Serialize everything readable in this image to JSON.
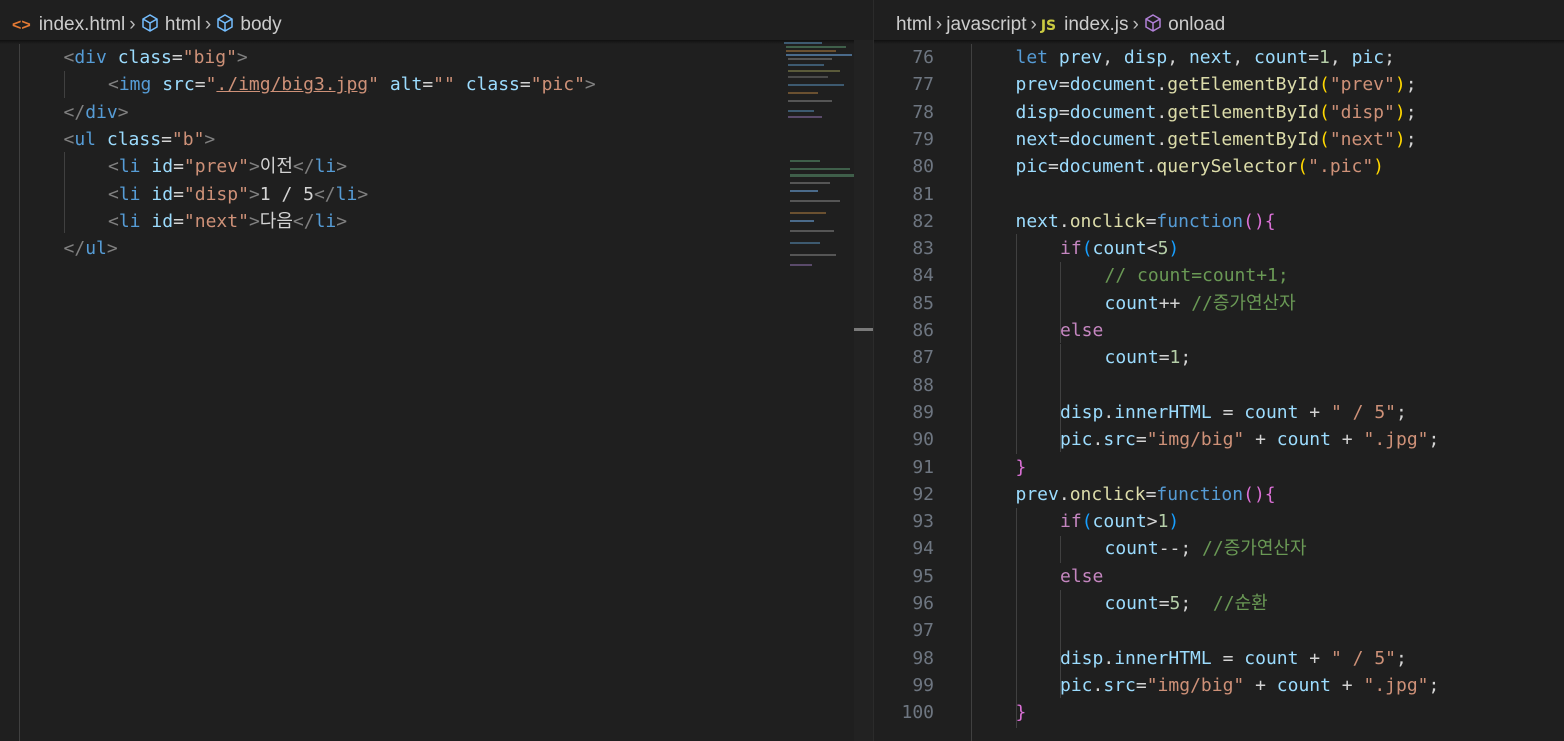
{
  "left": {
    "breadcrumb": [
      "index.html",
      "html",
      "body"
    ],
    "code": [
      {
        "indent": 1,
        "tokens": [
          [
            "tag",
            "<"
          ],
          [
            "tn",
            "div"
          ],
          [
            "pl",
            " "
          ],
          [
            "an",
            "class"
          ],
          [
            "pl",
            "="
          ],
          [
            "av",
            "\"big\""
          ],
          [
            "tag",
            ">"
          ]
        ]
      },
      {
        "indent": 2,
        "tokens": [
          [
            "tag",
            "<"
          ],
          [
            "tn",
            "img"
          ],
          [
            "pl",
            " "
          ],
          [
            "an",
            "src"
          ],
          [
            "pl",
            "="
          ],
          [
            "av",
            "\""
          ],
          [
            "avu",
            "./img/big3.jpg"
          ],
          [
            "av",
            "\""
          ],
          [
            "pl",
            " "
          ],
          [
            "an",
            "alt"
          ],
          [
            "pl",
            "="
          ],
          [
            "av",
            "\"\""
          ],
          [
            "pl",
            " "
          ],
          [
            "an",
            "class"
          ],
          [
            "pl",
            "="
          ],
          [
            "av",
            "\"pic\""
          ],
          [
            "tag",
            ">"
          ]
        ]
      },
      {
        "indent": 1,
        "tokens": [
          [
            "tag",
            "</"
          ],
          [
            "tn",
            "div"
          ],
          [
            "tag",
            ">"
          ]
        ]
      },
      {
        "indent": 1,
        "tokens": [
          [
            "tag",
            "<"
          ],
          [
            "tn",
            "ul"
          ],
          [
            "pl",
            " "
          ],
          [
            "an",
            "class"
          ],
          [
            "pl",
            "="
          ],
          [
            "av",
            "\"b\""
          ],
          [
            "tag",
            ">"
          ]
        ]
      },
      {
        "indent": 2,
        "tokens": [
          [
            "tag",
            "<"
          ],
          [
            "tn",
            "li"
          ],
          [
            "pl",
            " "
          ],
          [
            "an",
            "id"
          ],
          [
            "pl",
            "="
          ],
          [
            "av",
            "\"prev\""
          ],
          [
            "tag",
            ">"
          ],
          [
            "pl",
            "이전"
          ],
          [
            "tag",
            "</"
          ],
          [
            "tn",
            "li"
          ],
          [
            "tag",
            ">"
          ]
        ]
      },
      {
        "indent": 2,
        "tokens": [
          [
            "tag",
            "<"
          ],
          [
            "tn",
            "li"
          ],
          [
            "pl",
            " "
          ],
          [
            "an",
            "id"
          ],
          [
            "pl",
            "="
          ],
          [
            "av",
            "\"disp\""
          ],
          [
            "tag",
            ">"
          ],
          [
            "pl",
            "1 / 5"
          ],
          [
            "tag",
            "</"
          ],
          [
            "tn",
            "li"
          ],
          [
            "tag",
            ">"
          ]
        ]
      },
      {
        "indent": 2,
        "tokens": [
          [
            "tag",
            "<"
          ],
          [
            "tn",
            "li"
          ],
          [
            "pl",
            " "
          ],
          [
            "an",
            "id"
          ],
          [
            "pl",
            "="
          ],
          [
            "av",
            "\"next\""
          ],
          [
            "tag",
            ">"
          ],
          [
            "pl",
            "다음"
          ],
          [
            "tag",
            "</"
          ],
          [
            "tn",
            "li"
          ],
          [
            "tag",
            ">"
          ]
        ]
      },
      {
        "indent": 1,
        "tokens": [
          [
            "tag",
            "</"
          ],
          [
            "tn",
            "ul"
          ],
          [
            "tag",
            ">"
          ]
        ]
      }
    ]
  },
  "right": {
    "breadcrumb": [
      "html",
      "javascript",
      "index.js",
      "onload"
    ],
    "first_line": 76,
    "code": [
      {
        "indent": 1,
        "tokens": [
          [
            "kw",
            "let"
          ],
          [
            "pl",
            " "
          ],
          [
            "var",
            "prev"
          ],
          [
            "pl",
            ", "
          ],
          [
            "var",
            "disp"
          ],
          [
            "pl",
            ", "
          ],
          [
            "var",
            "next"
          ],
          [
            "pl",
            ", "
          ],
          [
            "var",
            "count"
          ],
          [
            "pl",
            "="
          ],
          [
            "num",
            "1"
          ],
          [
            "pl",
            ", "
          ],
          [
            "var",
            "pic"
          ],
          [
            "pl",
            ";"
          ]
        ]
      },
      {
        "indent": 1,
        "tokens": [
          [
            "var",
            "prev"
          ],
          [
            "pl",
            "="
          ],
          [
            "var",
            "document"
          ],
          [
            "pl",
            "."
          ],
          [
            "fn",
            "getElementById"
          ],
          [
            "br1",
            "("
          ],
          [
            "str",
            "\"prev\""
          ],
          [
            "br1",
            ")"
          ],
          [
            "pl",
            ";"
          ]
        ]
      },
      {
        "indent": 1,
        "tokens": [
          [
            "var",
            "disp"
          ],
          [
            "pl",
            "="
          ],
          [
            "var",
            "document"
          ],
          [
            "pl",
            "."
          ],
          [
            "fn",
            "getElementById"
          ],
          [
            "br1",
            "("
          ],
          [
            "str",
            "\"disp\""
          ],
          [
            "br1",
            ")"
          ],
          [
            "pl",
            ";"
          ]
        ]
      },
      {
        "indent": 1,
        "tokens": [
          [
            "var",
            "next"
          ],
          [
            "pl",
            "="
          ],
          [
            "var",
            "document"
          ],
          [
            "pl",
            "."
          ],
          [
            "fn",
            "getElementById"
          ],
          [
            "br1",
            "("
          ],
          [
            "str",
            "\"next\""
          ],
          [
            "br1",
            ")"
          ],
          [
            "pl",
            ";"
          ]
        ]
      },
      {
        "indent": 1,
        "tokens": [
          [
            "var",
            "pic"
          ],
          [
            "pl",
            "="
          ],
          [
            "var",
            "document"
          ],
          [
            "pl",
            "."
          ],
          [
            "fn",
            "querySelector"
          ],
          [
            "br1",
            "("
          ],
          [
            "str",
            "\".pic\""
          ],
          [
            "br1",
            ")"
          ]
        ]
      },
      {
        "indent": 0,
        "tokens": []
      },
      {
        "indent": 1,
        "tokens": [
          [
            "var",
            "next"
          ],
          [
            "pl",
            "."
          ],
          [
            "fn",
            "onclick"
          ],
          [
            "pl",
            "="
          ],
          [
            "kw",
            "function"
          ],
          [
            "br2",
            "("
          ],
          [
            "br2",
            ")"
          ],
          [
            "br2",
            "{"
          ]
        ]
      },
      {
        "indent": 2,
        "tokens": [
          [
            "ctl",
            "if"
          ],
          [
            "br3",
            "("
          ],
          [
            "var",
            "count"
          ],
          [
            "pl",
            "<"
          ],
          [
            "num",
            "5"
          ],
          [
            "br3",
            ")"
          ]
        ]
      },
      {
        "indent": 3,
        "tokens": [
          [
            "cm",
            "// count=count+1;"
          ]
        ]
      },
      {
        "indent": 3,
        "tokens": [
          [
            "var",
            "count"
          ],
          [
            "pl",
            "++ "
          ],
          [
            "cm",
            "//증가연산자"
          ]
        ]
      },
      {
        "indent": 2,
        "tokens": [
          [
            "ctl",
            "else"
          ]
        ]
      },
      {
        "indent": 3,
        "tokens": [
          [
            "var",
            "count"
          ],
          [
            "pl",
            "="
          ],
          [
            "num",
            "1"
          ],
          [
            "pl",
            ";"
          ]
        ]
      },
      {
        "indent": 0,
        "tokens": []
      },
      {
        "indent": 2,
        "tokens": [
          [
            "var",
            "disp"
          ],
          [
            "pl",
            "."
          ],
          [
            "var",
            "innerHTML"
          ],
          [
            "pl",
            " = "
          ],
          [
            "var",
            "count"
          ],
          [
            "pl",
            " + "
          ],
          [
            "str",
            "\" / 5\""
          ],
          [
            "pl",
            ";"
          ]
        ]
      },
      {
        "indent": 2,
        "tokens": [
          [
            "var",
            "pic"
          ],
          [
            "pl",
            "."
          ],
          [
            "var",
            "src"
          ],
          [
            "pl",
            "="
          ],
          [
            "str",
            "\"img/big\""
          ],
          [
            "pl",
            " + "
          ],
          [
            "var",
            "count"
          ],
          [
            "pl",
            " + "
          ],
          [
            "str",
            "\".jpg\""
          ],
          [
            "pl",
            ";"
          ]
        ]
      },
      {
        "indent": 1,
        "tokens": [
          [
            "br2",
            "}"
          ]
        ]
      },
      {
        "indent": 1,
        "tokens": [
          [
            "var",
            "prev"
          ],
          [
            "pl",
            "."
          ],
          [
            "fn",
            "onclick"
          ],
          [
            "pl",
            "="
          ],
          [
            "kw",
            "function"
          ],
          [
            "br2",
            "("
          ],
          [
            "br2",
            ")"
          ],
          [
            "br2",
            "{"
          ]
        ]
      },
      {
        "indent": 2,
        "tokens": [
          [
            "ctl",
            "if"
          ],
          [
            "br3",
            "("
          ],
          [
            "var",
            "count"
          ],
          [
            "pl",
            ">"
          ],
          [
            "num",
            "1"
          ],
          [
            "br3",
            ")"
          ]
        ]
      },
      {
        "indent": 3,
        "tokens": [
          [
            "var",
            "count"
          ],
          [
            "pl",
            "--; "
          ],
          [
            "cm",
            "//증가연산자"
          ]
        ]
      },
      {
        "indent": 2,
        "tokens": [
          [
            "ctl",
            "else"
          ]
        ]
      },
      {
        "indent": 3,
        "tokens": [
          [
            "var",
            "count"
          ],
          [
            "pl",
            "="
          ],
          [
            "num",
            "5"
          ],
          [
            "pl",
            ";  "
          ],
          [
            "cm",
            "//순환"
          ]
        ]
      },
      {
        "indent": 0,
        "tokens": []
      },
      {
        "indent": 2,
        "tokens": [
          [
            "var",
            "disp"
          ],
          [
            "pl",
            "."
          ],
          [
            "var",
            "innerHTML"
          ],
          [
            "pl",
            " = "
          ],
          [
            "var",
            "count"
          ],
          [
            "pl",
            " + "
          ],
          [
            "str",
            "\" / 5\""
          ],
          [
            "pl",
            ";"
          ]
        ]
      },
      {
        "indent": 2,
        "tokens": [
          [
            "var",
            "pic"
          ],
          [
            "pl",
            "."
          ],
          [
            "var",
            "src"
          ],
          [
            "pl",
            "="
          ],
          [
            "str",
            "\"img/big\""
          ],
          [
            "pl",
            " + "
          ],
          [
            "var",
            "count"
          ],
          [
            "pl",
            " + "
          ],
          [
            "str",
            "\".jpg\""
          ],
          [
            "pl",
            ";"
          ]
        ]
      },
      {
        "indent": 1,
        "tokens": [
          [
            "br2",
            "}"
          ]
        ]
      }
    ]
  },
  "icons": {
    "html_file": "html-file-icon",
    "js_file": "js-file-icon",
    "symbol": "cube-icon",
    "method": "method-cube-icon"
  },
  "colors": {
    "background": "#1f1f1f",
    "keyword": "#569cd6",
    "variable": "#9cdcfe",
    "function": "#dcdcaa",
    "string": "#ce9178",
    "comment": "#6a9955",
    "control": "#c586c0",
    "number": "#b5cea8"
  }
}
